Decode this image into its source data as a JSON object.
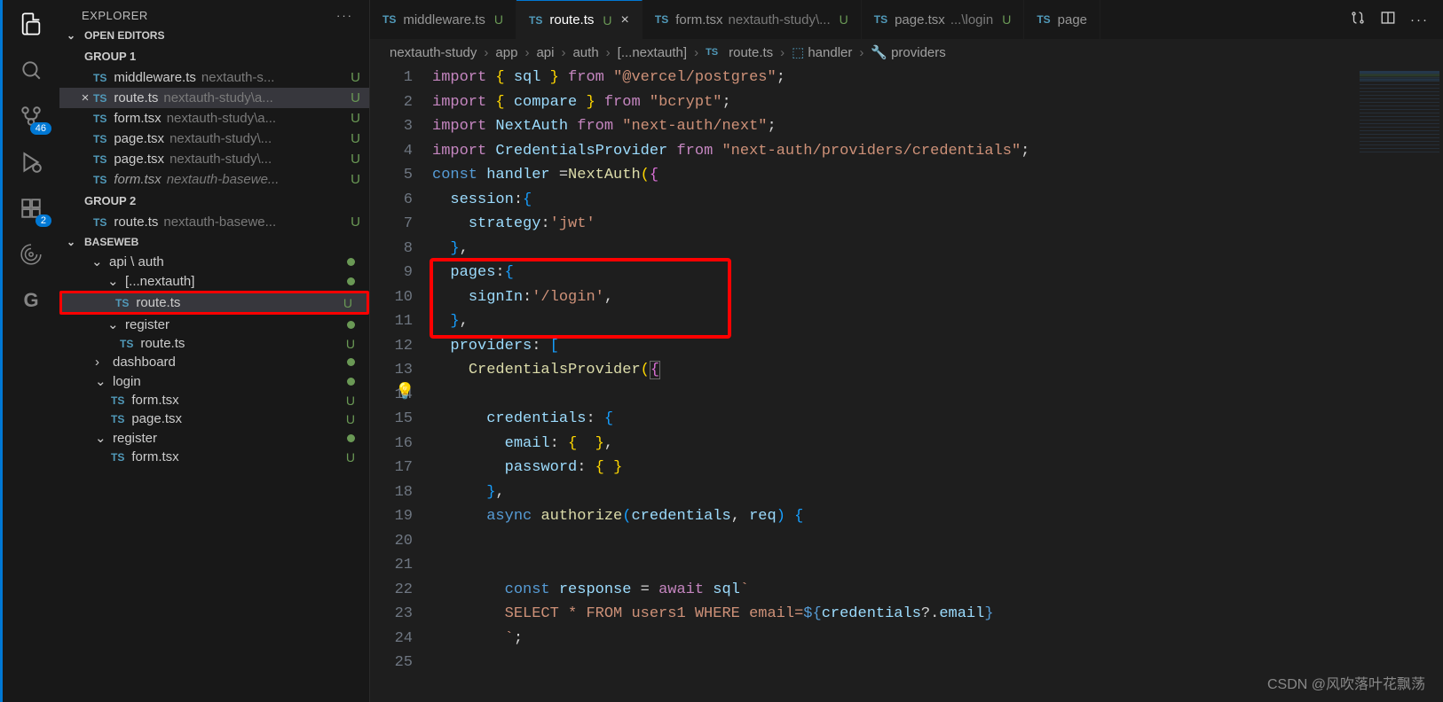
{
  "explorer": {
    "title": "EXPLORER",
    "openEditors": "OPEN EDITORS",
    "group1": "GROUP 1",
    "group2": "GROUP 2",
    "workspace": "BASEWEB"
  },
  "openFiles": [
    {
      "name": "middleware.ts",
      "path": "nextauth-s...",
      "status": "U"
    },
    {
      "name": "route.ts",
      "path": "nextauth-study\\a...",
      "status": "U",
      "active": true
    },
    {
      "name": "form.tsx",
      "path": "nextauth-study\\a...",
      "status": "U"
    },
    {
      "name": "page.tsx",
      "path": "nextauth-study\\...",
      "status": "U"
    },
    {
      "name": "page.tsx",
      "path": "nextauth-study\\...",
      "status": "U"
    },
    {
      "name": "form.tsx",
      "path": "nextauth-basewe...",
      "status": "U",
      "italic": true
    }
  ],
  "group2Files": [
    {
      "name": "route.ts",
      "path": "nextauth-basewe...",
      "status": "U"
    }
  ],
  "tree": {
    "apiAuth": "api \\ auth",
    "nextauth": "[...nextauth]",
    "route1": "route.ts",
    "register": "register",
    "route2": "route.ts",
    "dashboard": "dashboard",
    "login": "login",
    "form1": "form.tsx",
    "page1": "page.tsx",
    "registerFolder": "register",
    "form2": "form.tsx"
  },
  "tabs": [
    {
      "name": "middleware.ts",
      "status": "U"
    },
    {
      "name": "route.ts",
      "status": "U",
      "active": true
    },
    {
      "name": "form.tsx",
      "path": "nextauth-study\\...",
      "status": "U"
    },
    {
      "name": "page.tsx",
      "path": "...\\login",
      "status": "U"
    },
    {
      "name": "page"
    }
  ],
  "breadcrumb": {
    "p1": "nextauth-study",
    "p2": "app",
    "p3": "api",
    "p4": "auth",
    "p5": "[...nextauth]",
    "p6": "route.ts",
    "p7": "handler",
    "p8": "providers"
  },
  "badge46": "46",
  "badge2": "2",
  "watermark": "CSDN @风吹落叶花飘荡",
  "code": {
    "l1": {
      "a": "import",
      "b": "{",
      "c": "sql",
      "d": "}",
      "e": "from",
      "f": "\"@vercel/postgres\"",
      "g": ";"
    },
    "l2": {
      "a": "import",
      "b": "{",
      "c": "compare",
      "d": "}",
      "e": "from",
      "f": "\"bcrypt\"",
      "g": ";"
    },
    "l3": {
      "a": "import",
      "b": "NextAuth",
      "c": "from",
      "d": "\"next-auth/next\"",
      "e": ";"
    },
    "l4": {
      "a": "import",
      "b": "CredentialsProvider",
      "c": "from",
      "d": "\"next-auth/providers/credentials\"",
      "e": ";"
    },
    "l5": {
      "a": "const",
      "b": "handler",
      "c": "=",
      "d": "NextAuth",
      "e": "(",
      "f": "{"
    },
    "l6": {
      "a": "session",
      "b": ":",
      "c": "{"
    },
    "l7": {
      "a": "strategy",
      "b": ":",
      "c": "'jwt'"
    },
    "l8": {
      "a": "}",
      "b": ","
    },
    "l9": {
      "a": "pages",
      "b": ":",
      "c": "{"
    },
    "l10": {
      "a": "signIn",
      "b": ":",
      "c": "'/login'",
      "d": ","
    },
    "l11": {
      "a": "}",
      "b": ","
    },
    "l12": {
      "a": "providers",
      "b": ":",
      "c": "["
    },
    "l13": {
      "a": "CredentialsProvider",
      "b": "(",
      "c": "{"
    },
    "l15": {
      "a": "credentials",
      "b": ":",
      "c": "{"
    },
    "l16": {
      "a": "email",
      "b": ":",
      "c": "{",
      "d": "}",
      "e": ","
    },
    "l17": {
      "a": "password",
      "b": ":",
      "c": "{",
      "d": "}"
    },
    "l18": {
      "a": "}",
      "b": ","
    },
    "l19": {
      "a": "async",
      "b": "authorize",
      "c": "(",
      "d": "credentials",
      "e": ",",
      "f": "req",
      "g": ")",
      "h": "{"
    },
    "l22": {
      "a": "const",
      "b": "response",
      "c": "=",
      "d": "await",
      "e": "sql",
      "f": "`"
    },
    "l23": {
      "a": "SELECT * FROM users1 WHERE email=",
      "b": "${",
      "c": "credentials",
      "d": "?.",
      "e": "email",
      "f": "}"
    },
    "l24": {
      "a": "`",
      "b": ";"
    }
  }
}
